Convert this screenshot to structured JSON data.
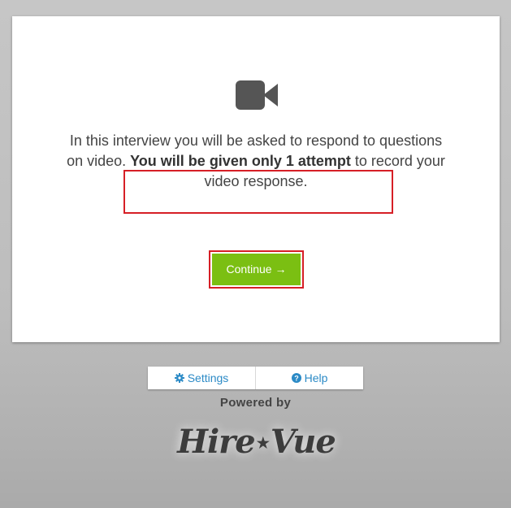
{
  "message": {
    "part1": "In this interview you will be asked to respond to questions on video. ",
    "bold": "You will be given only 1 attempt",
    "part2": " to record your video response."
  },
  "continue_button": {
    "label": "Continue →"
  },
  "footer": {
    "settings_label": "Settings",
    "help_label": "Help",
    "powered_by": "Powered by",
    "logo_left": "Hire",
    "logo_star": "★",
    "logo_right": "Vue"
  },
  "icons": {
    "video": "video-camera-icon",
    "settings": "gear-icon",
    "help": "question-circle-icon"
  },
  "colors": {
    "accent_green": "#7bbf12",
    "link_blue": "#2b8ac6",
    "highlight_red": "#d61f26",
    "icon_gray": "#555555"
  }
}
